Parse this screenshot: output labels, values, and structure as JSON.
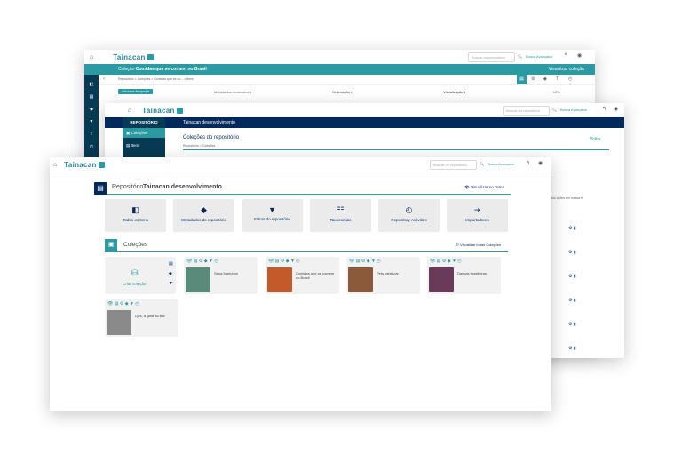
{
  "back_window": {
    "logo": "Tainacan",
    "search_placeholder": "Buscar no repositório",
    "advanced_search": "Busca Avançada",
    "collection_title_prefix": "Coleção",
    "collection_title": "Comidas que se comem no Brasil",
    "view_collection": "Visualizar coleção",
    "breadcrumb": "Repositório > Coleções > Comidas que se co... > Itens",
    "add_item_button": "Adicionar item(ns) ▾",
    "displayed_metadata": "Metadados mostrados ▾",
    "sorting": "Ordenação ▾",
    "view_mode": "Visualização ▾",
    "url": "URL"
  },
  "middle_window": {
    "logo": "Tainacan",
    "search_placeholder": "Buscar no repositório",
    "advanced_search": "Busca Avançada",
    "repo_label": "REPOSITÓRIO",
    "repo_name": "Tainacan desenvolvimento",
    "side_items": [
      "Coleções",
      "Itens"
    ],
    "page_title": "Coleções do repositório",
    "breadcrumb": "Repositório > Coleções",
    "back_link": "Voltar",
    "column_hint": "tos ações em massa ▾"
  },
  "front_window": {
    "logo": "Tainacan",
    "search_placeholder": "Buscar no repositório",
    "advanced_search": "Busca Avançada",
    "repo_prefix": "Repositório",
    "repo_name": "Tainacan desenvolvimento",
    "view_theme": "Visualizar no Tema",
    "tiles": [
      {
        "label": "Todos os itens",
        "icon": "◧"
      },
      {
        "label": "Metadados do repositório",
        "icon": "◆"
      },
      {
        "label": "Filtros do repositório",
        "icon": "▼"
      },
      {
        "label": "Taxonomias",
        "icon": "☷"
      },
      {
        "label": "Repository Activities",
        "icon": "◴"
      },
      {
        "label": "Importadores",
        "icon": "⇥"
      }
    ],
    "collections_title": "Coleções",
    "view_all_collections": "Visualizar todas Coleções",
    "create_collection": "Criar coleção",
    "collections": [
      {
        "name": "Sena Marinhos",
        "color": "#5a8a7a"
      },
      {
        "name": "Comidas que se comem no Brasil",
        "color": "#c45a2a"
      },
      {
        "name": "Pets catalivos",
        "color": "#8b5a3a"
      },
      {
        "name": "Danças brasileiras",
        "color": "#6a3a5a"
      },
      {
        "name": "Lyra, a gata da Bia",
        "color": "#8a8a8a"
      }
    ]
  }
}
